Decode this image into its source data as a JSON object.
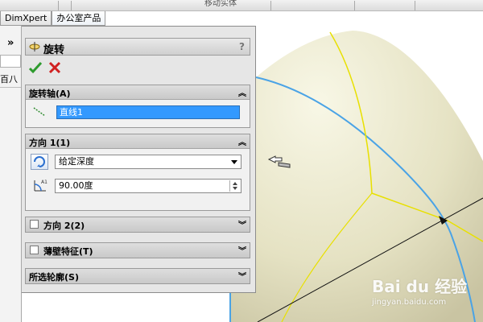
{
  "tabs": [
    {
      "label": "DimXpert"
    },
    {
      "label": "办公室产品"
    }
  ],
  "top_toolbar": {
    "move_entity_label": "移动实体"
  },
  "left_strip": {
    "expand_label": "»",
    "partial_text": "百八"
  },
  "property_manager": {
    "title": "旋转",
    "help_label": "?",
    "icons": {
      "title": "revolve-icon",
      "ok": "checkmark-icon",
      "cancel": "close-icon"
    },
    "colors": {
      "ok": "#2e9b2e",
      "cancel": "#d02020",
      "selection_highlight": "#3399ff"
    },
    "axis_group": {
      "header": "旋转轴(A)",
      "value": "直线1"
    },
    "direction1_group": {
      "header": "方向 1(1)",
      "end_condition": "给定深度",
      "angle": "90.00度"
    },
    "direction2_group": {
      "header": "方向 2(2)"
    },
    "thin_feature_group": {
      "header": "薄壁特征(T)"
    },
    "selected_contours_group": {
      "header": "所选轮廓(S)"
    }
  },
  "watermark": {
    "brand": "Bai du 经验",
    "site": "jingyan.baidu.com"
  }
}
